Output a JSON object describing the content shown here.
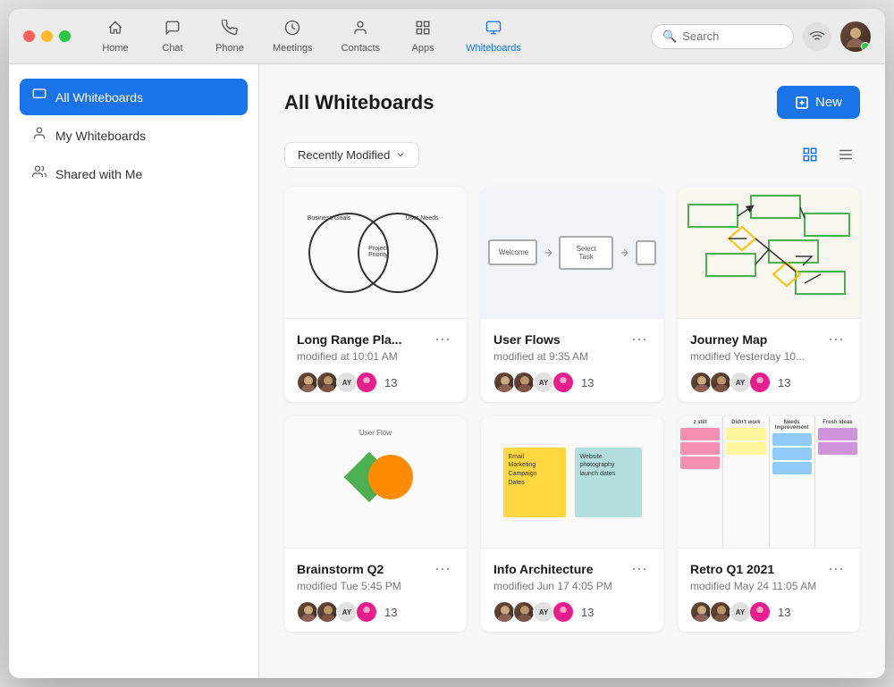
{
  "window": {
    "title": "Whiteboards"
  },
  "nav": {
    "items": [
      {
        "id": "home",
        "label": "Home",
        "icon": "⌂",
        "active": false
      },
      {
        "id": "chat",
        "label": "Chat",
        "icon": "💬",
        "active": false
      },
      {
        "id": "phone",
        "label": "Phone",
        "icon": "📞",
        "active": false
      },
      {
        "id": "meetings",
        "label": "Meetings",
        "icon": "🕐",
        "active": false
      },
      {
        "id": "contacts",
        "label": "Contacts",
        "icon": "👤",
        "active": false
      },
      {
        "id": "apps",
        "label": "Apps",
        "icon": "⊞",
        "active": false
      },
      {
        "id": "whiteboards",
        "label": "Whiteboards",
        "icon": "🖥",
        "active": true
      }
    ],
    "search": {
      "placeholder": "Search"
    }
  },
  "sidebar": {
    "items": [
      {
        "id": "all",
        "label": "All Whiteboards",
        "icon": "▭",
        "active": true
      },
      {
        "id": "my",
        "label": "My Whiteboards",
        "icon": "👤",
        "active": false
      },
      {
        "id": "shared",
        "label": "Shared with Me",
        "icon": "👥",
        "active": false
      }
    ]
  },
  "content": {
    "title": "All Whiteboards",
    "new_button": "New",
    "sort_label": "Recently Modified",
    "whiteboards": [
      {
        "id": "wb1",
        "title": "Long Range Pla...",
        "modified": "modified at 10:01 AM",
        "participant_count": "13",
        "type": "venn"
      },
      {
        "id": "wb2",
        "title": "User Flows",
        "modified": "modified at 9:35 AM",
        "participant_count": "13",
        "type": "flow"
      },
      {
        "id": "wb3",
        "title": "Journey Map",
        "modified": "modified Yesterday 10...",
        "participant_count": "13",
        "type": "journey"
      },
      {
        "id": "wb4",
        "title": "Brainstorm Q2",
        "modified": "modified Tue 5:45 PM",
        "participant_count": "13",
        "type": "brainstorm"
      },
      {
        "id": "wb5",
        "title": "Info Architecture",
        "modified": "modified Jun 17 4:05 PM",
        "participant_count": "13",
        "type": "info"
      },
      {
        "id": "wb6",
        "title": "Retro Q1 2021",
        "modified": "modified May 24 11:05 AM",
        "participant_count": "13",
        "type": "retro"
      }
    ]
  },
  "colors": {
    "accent": "#1a73e8",
    "active_nav": "#1a73e8"
  }
}
